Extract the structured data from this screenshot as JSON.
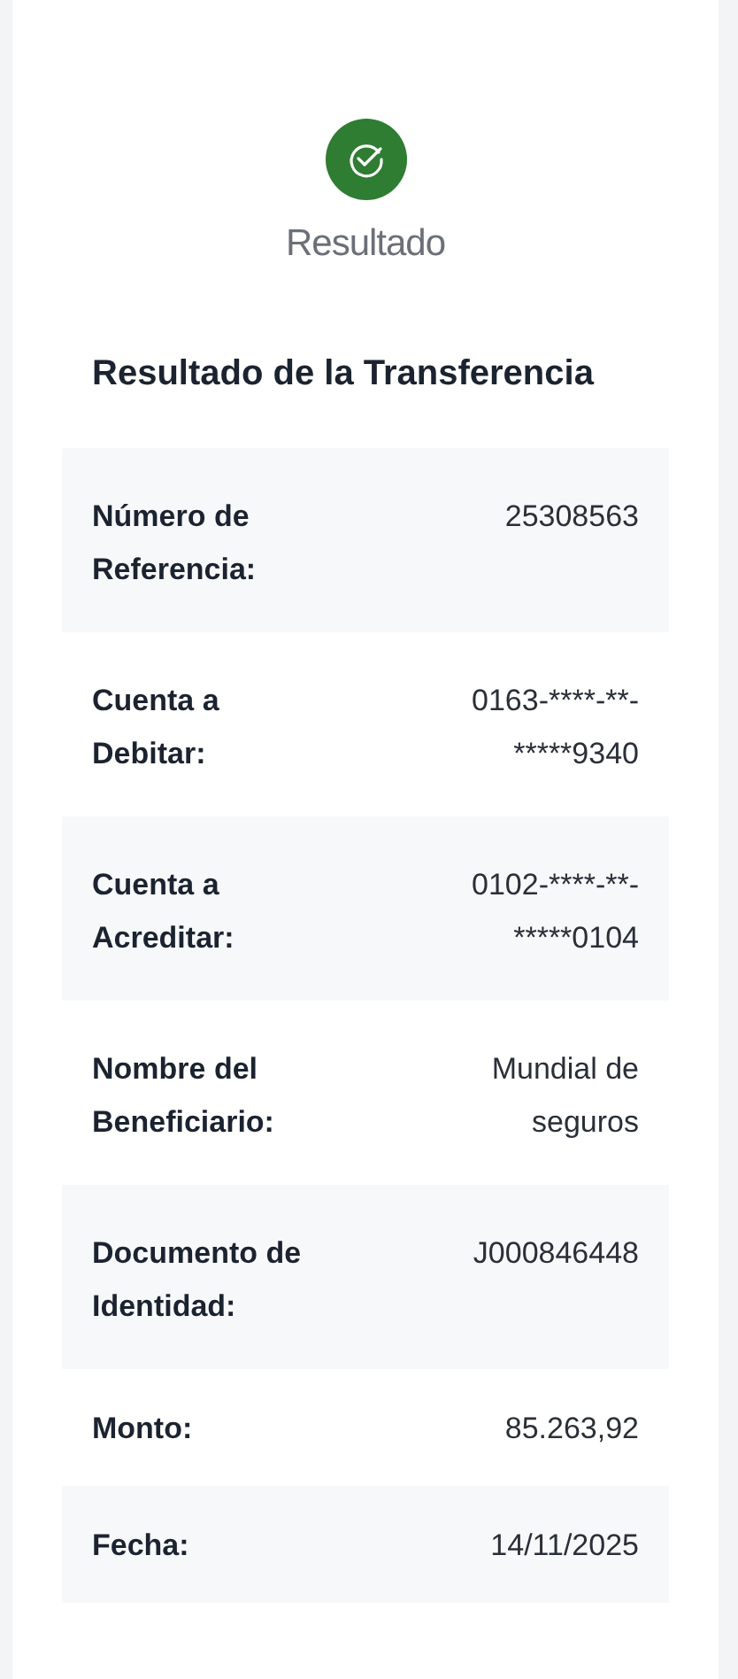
{
  "status": {
    "label": "Resultado"
  },
  "title": "Resultado de la Transferencia",
  "rows": [
    {
      "label": "Número de Referencia:",
      "value": "25308563"
    },
    {
      "label": "Cuenta a Debitar:",
      "value": "0163-****-**-*****9340"
    },
    {
      "label": "Cuenta a Acreditar:",
      "value": "0102-****-**-*****0104"
    },
    {
      "label": "Nombre del Beneficiario:",
      "value": "Mundial de seguros"
    },
    {
      "label": "Documento de Identidad:",
      "value": "J000846448"
    },
    {
      "label": "Monto:",
      "value": "85.263,92"
    },
    {
      "label": "Fecha:",
      "value": "14/11/2025"
    }
  ]
}
